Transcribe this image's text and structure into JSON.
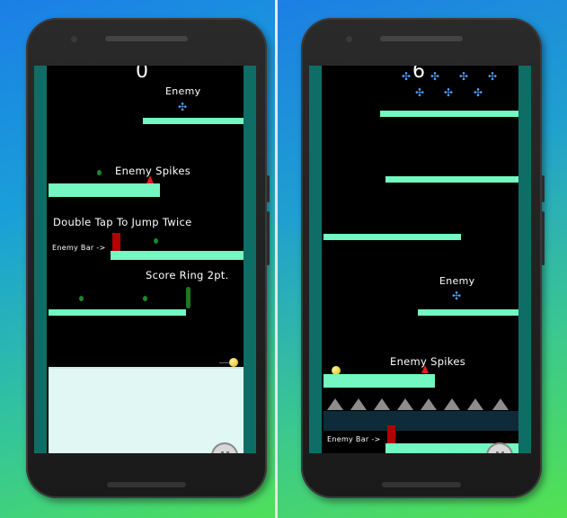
{
  "left_screen": {
    "score": "0",
    "labels": {
      "enemy": "Enemy",
      "enemy_spikes": "Enemy Spikes",
      "double_tap": "Double Tap To Jump Twice",
      "enemy_bar": "Enemy Bar ->",
      "score_ring": "Score Ring 2pt."
    }
  },
  "right_screen": {
    "score": "6",
    "labels": {
      "enemy": "Enemy",
      "enemy_spikes": "Enemy Spikes",
      "enemy_bar": "Enemy Bar ->"
    }
  },
  "icons": {
    "enemy": "enemy-star-icon",
    "pause": "pause-icon",
    "spike": "spike-icon"
  },
  "colors": {
    "platform": "#74f7c0",
    "rail": "#0e6e65",
    "enemy_bar": "#b30000",
    "spike": "#e01c1c",
    "ball": "#e0b000",
    "floor": "#e0f7f3"
  }
}
